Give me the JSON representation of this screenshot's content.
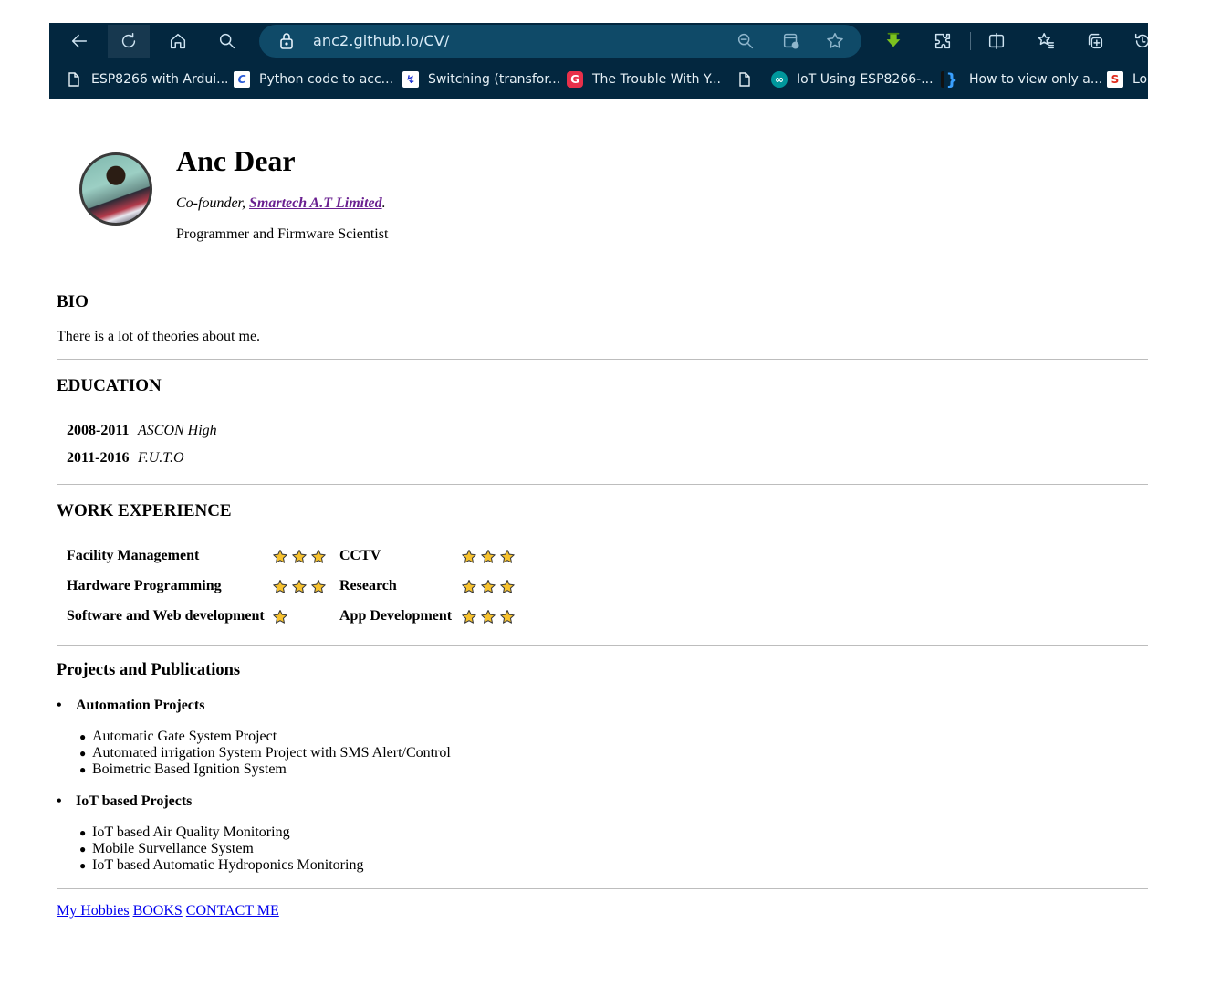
{
  "browser": {
    "url": "anc2.github.io/CV/",
    "toolbar_icons": [
      "back-icon",
      "refresh-icon",
      "home-icon",
      "search-icon"
    ],
    "address_icons": [
      "zoom-out-icon",
      "app-available-icon",
      "favorite-star-icon"
    ],
    "right_icons": [
      "download-icon",
      "extensions-icon",
      "split-screen-icon",
      "favorites-list-icon",
      "collections-icon",
      "history-icon"
    ],
    "bookmarks": [
      {
        "label": "ESP8266 with Ardui...",
        "icon": "page-icon"
      },
      {
        "label": "Python code to acc...",
        "icon": "c-logo-icon",
        "glyph": "C",
        "bg": "#ffffff",
        "fg": "#2a5bd7"
      },
      {
        "label": "Switching (transfor...",
        "icon": "bolt-icon",
        "glyph": "↯",
        "bg": "#ffffff",
        "fg": "#1b2fd0"
      },
      {
        "label": "The Trouble With Y...",
        "icon": "g-logo-icon",
        "glyph": "G",
        "bg": "#e8304a",
        "fg": "#ffffff"
      },
      {
        "label": "",
        "icon": "page-icon"
      },
      {
        "label": "IoT Using ESP8266-...",
        "icon": "arduino-icon",
        "glyph": "∞",
        "bg": "#00979c",
        "fg": "#ffffff"
      },
      {
        "label": "How to view only a...",
        "icon": "brackets-icon",
        "glyph": "}",
        "bg": "transparent",
        "fg": "#3aa0ff"
      },
      {
        "label": "Lo",
        "icon": "sparkfun-icon",
        "glyph": "S",
        "bg": "#ffffff",
        "fg": "#e02a1c"
      }
    ]
  },
  "profile": {
    "name": "Anc Dear",
    "role_prefix": "Co-founder, ",
    "company": "Smartech A.T Limited",
    "role_suffix": ".",
    "tagline": "Programmer and Firmware Scientist"
  },
  "bio": {
    "heading": "BIO",
    "text": "There is a lot of theories about me."
  },
  "education": {
    "heading": "EDUCATION",
    "rows": [
      {
        "years": "2008-2011",
        "school": "ASCON High"
      },
      {
        "years": "2011-2016",
        "school": "F.U.T.O"
      }
    ]
  },
  "work": {
    "heading": "WORK EXPERIENCE",
    "skills": [
      {
        "name": "Facility Management",
        "stars": 3
      },
      {
        "name": "CCTV",
        "stars": 3
      },
      {
        "name": "Hardware Programming",
        "stars": 3
      },
      {
        "name": "Research",
        "stars": 3
      },
      {
        "name": "Software and Web development",
        "stars": 1
      },
      {
        "name": "App Development",
        "stars": 3
      }
    ],
    "star_color": "#f7c22e"
  },
  "projects": {
    "heading": "Projects and Publications",
    "groups": [
      {
        "title": "Automation Projects",
        "items": [
          "Automatic Gate System Project",
          "Automated irrigation System Project with SMS Alert/Control",
          "Boimetric Based Ignition System"
        ]
      },
      {
        "title": "IoT based Projects",
        "items": [
          "IoT based Air Quality Monitoring",
          "Mobile Survellance System",
          "IoT based Automatic Hydroponics Monitoring"
        ]
      }
    ]
  },
  "footer_links": [
    "My Hobbies",
    "BOOKS",
    "CONTACT ME"
  ],
  "colors": {
    "chrome_bg": "#03273f",
    "address_bg": "#0f4a68",
    "visited_link": "#6a2090",
    "link": "#0000ee"
  }
}
